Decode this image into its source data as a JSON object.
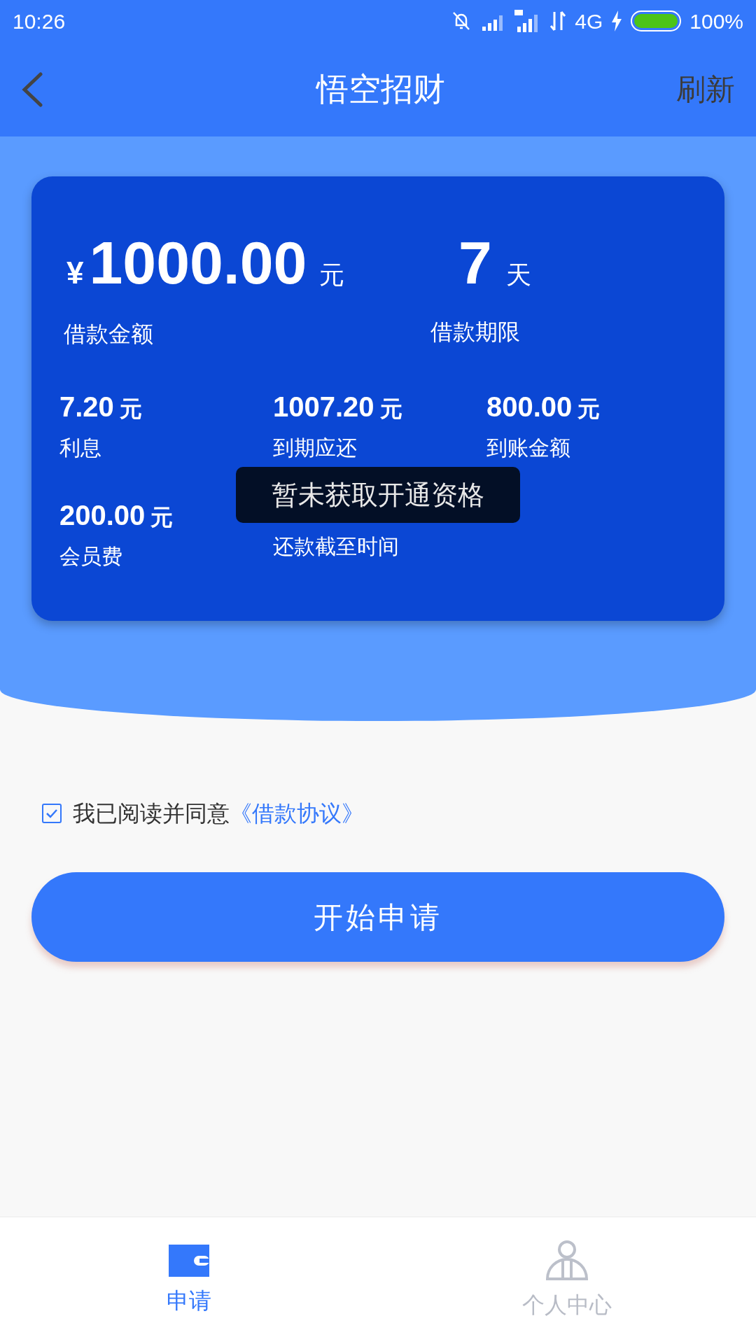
{
  "status_bar": {
    "time": "10:26",
    "battery": "100%",
    "network": "4G"
  },
  "header": {
    "title": "悟空招财",
    "action": "刷新"
  },
  "card": {
    "amount": {
      "currency": "¥",
      "value": "1000.00",
      "unit": "元",
      "label": "借款金额"
    },
    "term": {
      "value": "7",
      "unit": "天",
      "label": "借款期限"
    },
    "details": [
      {
        "value": "7.20",
        "unit": "元",
        "label": "利息"
      },
      {
        "value": "1007.20",
        "unit": "元",
        "label": "到期应还"
      },
      {
        "value": "800.00",
        "unit": "元",
        "label": "到账金额"
      },
      {
        "value": "200.00",
        "unit": "元",
        "label": "会员费"
      },
      {
        "label": "还款截至时间"
      }
    ]
  },
  "toast": "暂未获取开通资格",
  "agreement": {
    "checked": true,
    "text": "我已阅读并同意",
    "link": "《借款协议》"
  },
  "submit_button": "开始申请",
  "tab_bar": [
    {
      "label": "申请",
      "selected": true,
      "kind": "wallet"
    },
    {
      "label": "个人中心",
      "selected": false,
      "kind": "person"
    }
  ]
}
